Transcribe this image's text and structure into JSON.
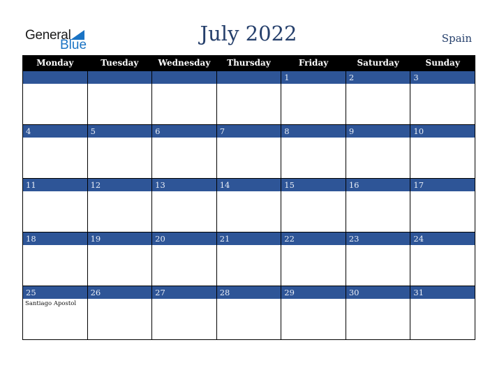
{
  "brand": {
    "line1": "General",
    "line2": "Blue",
    "accent_color": "#1a73c4"
  },
  "header": {
    "title": "July 2022",
    "country": "Spain"
  },
  "colors": {
    "header_bg": "#000000",
    "day_band": "#2e5597",
    "title": "#253f6b"
  },
  "weekdays": [
    "Monday",
    "Tuesday",
    "Wednesday",
    "Thursday",
    "Friday",
    "Saturday",
    "Sunday"
  ],
  "weeks": [
    [
      {
        "day": ""
      },
      {
        "day": ""
      },
      {
        "day": ""
      },
      {
        "day": ""
      },
      {
        "day": "1"
      },
      {
        "day": "2"
      },
      {
        "day": "3"
      }
    ],
    [
      {
        "day": "4"
      },
      {
        "day": "5"
      },
      {
        "day": "6"
      },
      {
        "day": "7"
      },
      {
        "day": "8"
      },
      {
        "day": "9"
      },
      {
        "day": "10"
      }
    ],
    [
      {
        "day": "11"
      },
      {
        "day": "12"
      },
      {
        "day": "13"
      },
      {
        "day": "14"
      },
      {
        "day": "15"
      },
      {
        "day": "16"
      },
      {
        "day": "17"
      }
    ],
    [
      {
        "day": "18"
      },
      {
        "day": "19"
      },
      {
        "day": "20"
      },
      {
        "day": "21"
      },
      {
        "day": "22"
      },
      {
        "day": "23"
      },
      {
        "day": "24"
      }
    ],
    [
      {
        "day": "25",
        "event": "Santiago Apostol"
      },
      {
        "day": "26"
      },
      {
        "day": "27"
      },
      {
        "day": "28"
      },
      {
        "day": "29"
      },
      {
        "day": "30"
      },
      {
        "day": "31"
      }
    ]
  ]
}
